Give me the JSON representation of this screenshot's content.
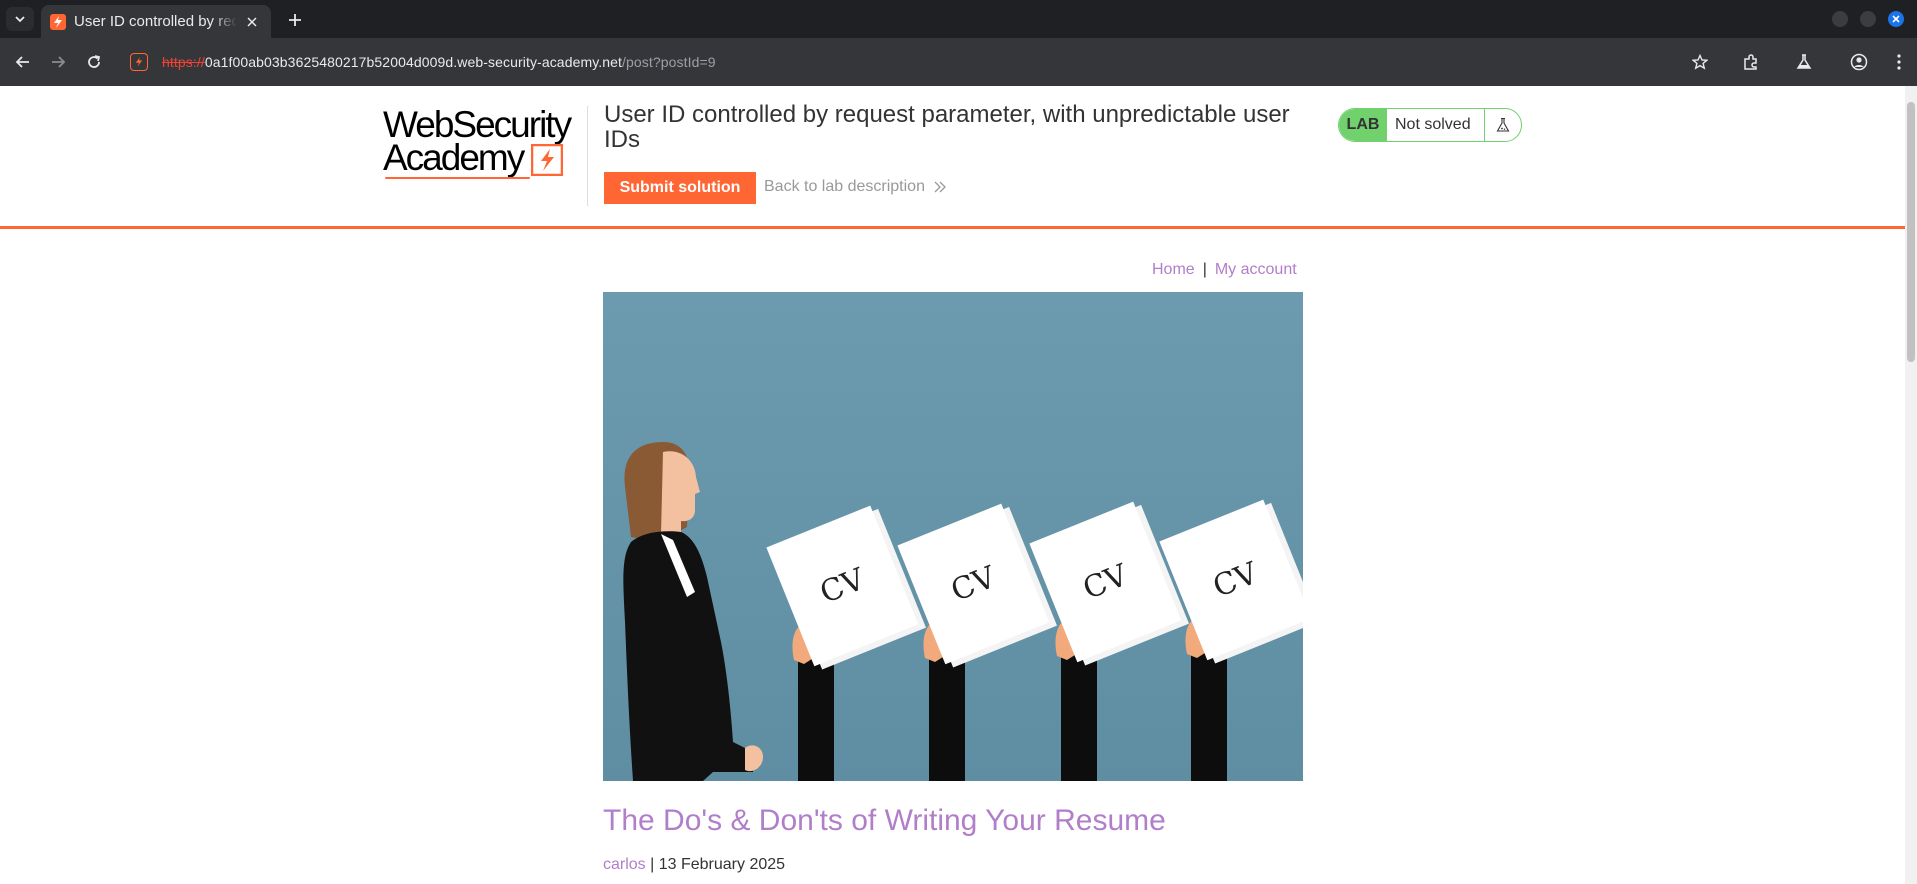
{
  "browser": {
    "tab_title": "User ID controlled by request parameter, with unpredictable user IDs",
    "url_scheme": "https://",
    "url_host": "0a1f00ab03b3625480217b52004d009d.web-security-academy.net",
    "url_path": "/post?postId=9"
  },
  "header": {
    "logo_line1": "WebSecurity",
    "logo_line2": "Academy",
    "lab_title": "User ID controlled by request parameter, with unpredictable user IDs",
    "submit_label": "Submit solution",
    "back_label": "Back to lab description",
    "lab_tag": "LAB",
    "lab_status": "Not solved"
  },
  "nav": {
    "home": "Home",
    "separator": "|",
    "account": "My account"
  },
  "post": {
    "cv_label": "CV",
    "title": "The Do's & Don'ts of Writing Your Resume",
    "author": "carlos",
    "meta_sep": " | ",
    "date": "13 February 2025"
  },
  "colors": {
    "accent": "#ff6633",
    "link": "#b17ec9",
    "lab_green": "#70d16d",
    "hero_bg": "#6a97ab"
  }
}
